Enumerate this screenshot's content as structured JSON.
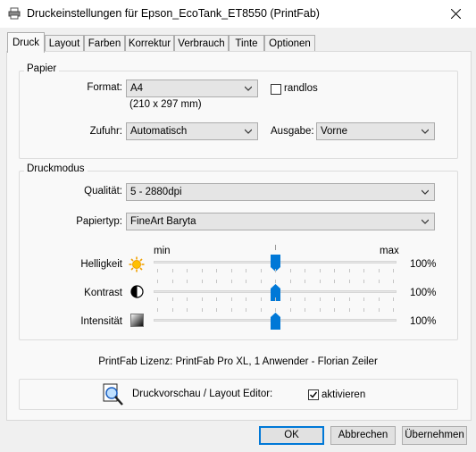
{
  "window": {
    "title": "Druckeinstellungen für Epson_EcoTank_ET8550 (PrintFab)"
  },
  "tabs": [
    "Druck",
    "Layout",
    "Farben",
    "Korrektur",
    "Verbrauch",
    "Tinte",
    "Optionen"
  ],
  "papier": {
    "legend": "Papier",
    "format_label": "Format:",
    "format_value": "A4",
    "format_size": "(210 x 297 mm)",
    "randlos_label": "randlos",
    "zufuhr_label": "Zufuhr:",
    "zufuhr_value": "Automatisch",
    "ausgabe_label": "Ausgabe:",
    "ausgabe_value": "Vorne"
  },
  "druckmodus": {
    "legend": "Druckmodus",
    "qualitaet_label": "Qualität:",
    "qualitaet_value": "5 - 2880dpi",
    "papiertyp_label": "Papiertyp:",
    "papiertyp_value": "FineArt Baryta",
    "scale_min": "min",
    "scale_max": "max",
    "helligkeit_label": "Helligkeit",
    "helligkeit_value": "100%",
    "kontrast_label": "Kontrast",
    "kontrast_value": "100%",
    "intensitaet_label": "Intensität",
    "intensitaet_value": "100%"
  },
  "license": "PrintFab Lizenz: PrintFab Pro XL, 1 Anwender - Florian Zeiler",
  "preview": {
    "label": "Druckvorschau / Layout Editor:",
    "checkbox_label": "aktivieren",
    "checked": true
  },
  "buttons": {
    "ok": "OK",
    "cancel": "Abbrechen",
    "apply": "Übernehmen"
  },
  "icons": {
    "app": "printer-icon",
    "close": "close-icon",
    "brightness": "sun-icon",
    "contrast": "contrast-icon",
    "intensity": "gradient-icon",
    "preview": "magnifier-document-icon"
  }
}
